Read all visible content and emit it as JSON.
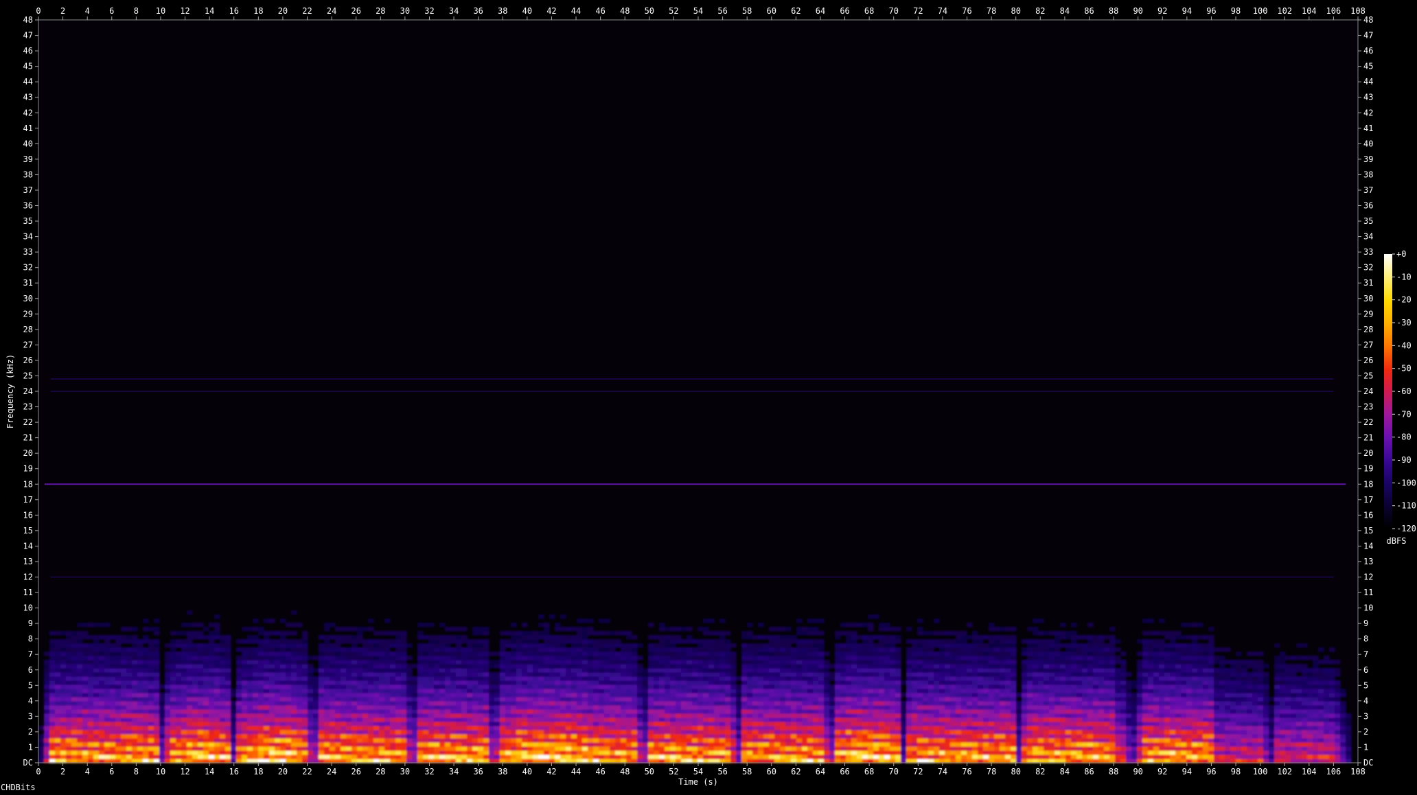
{
  "app": {
    "footer_label": "CHDBits"
  },
  "chart_data": {
    "type": "heatmap",
    "title": "",
    "xlabel": "Time (s)",
    "ylabel": "Frequency (kHz)",
    "xlim": [
      0,
      108
    ],
    "ylim": [
      0,
      48
    ],
    "x_ticks": [
      "0",
      "2",
      "4",
      "6",
      "8",
      "10",
      "12",
      "14",
      "16",
      "18",
      "20",
      "22",
      "24",
      "26",
      "28",
      "30",
      "32",
      "34",
      "36",
      "38",
      "40",
      "42",
      "44",
      "46",
      "48",
      "50",
      "52",
      "54",
      "56",
      "58",
      "60",
      "62",
      "64",
      "66",
      "68",
      "70",
      "72",
      "74",
      "76",
      "78",
      "80",
      "82",
      "84",
      "86",
      "88",
      "90",
      "92",
      "94",
      "96",
      "98",
      "100",
      "102",
      "104",
      "106",
      "108"
    ],
    "y_ticks": [
      "DC",
      "1",
      "2",
      "3",
      "4",
      "5",
      "6",
      "7",
      "8",
      "9",
      "10",
      "11",
      "12",
      "13",
      "14",
      "15",
      "16",
      "17",
      "18",
      "19",
      "20",
      "21",
      "22",
      "23",
      "24",
      "25",
      "26",
      "27",
      "28",
      "29",
      "30",
      "31",
      "32",
      "33",
      "34",
      "35",
      "36",
      "37",
      "38",
      "39",
      "40",
      "41",
      "42",
      "43",
      "44",
      "45",
      "46",
      "47",
      "48"
    ],
    "colorbar": {
      "label": "dBFS",
      "ticks": [
        "+0",
        "-10",
        "-20",
        "-30",
        "-40",
        "-50",
        "-60",
        "-70",
        "-80",
        "-90",
        "-100",
        "-110",
        "-120"
      ],
      "range": [
        -120,
        0
      ]
    },
    "colormap": [
      "#000000",
      "#0b0230",
      "#1a0466",
      "#3a0896",
      "#6a10b0",
      "#a0189a",
      "#d01a50",
      "#f02a10",
      "#ff7a00",
      "#ffc400",
      "#ffee60",
      "#ffffff"
    ],
    "grid": false,
    "features": {
      "tonal_line_khz": 18,
      "faint_lines_khz": [
        24,
        24.8,
        12
      ],
      "silence_gaps_s": [
        10.2,
        16.0,
        22.5,
        30.6,
        37.3,
        49.5,
        57.2,
        64.8,
        70.8,
        80.3,
        89.5,
        100.8
      ]
    }
  }
}
